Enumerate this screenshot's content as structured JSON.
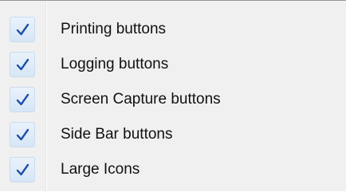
{
  "menu": {
    "items": [
      {
        "label": "Printing buttons",
        "checked": true,
        "icon": "checkmark-icon"
      },
      {
        "label": "Logging buttons",
        "checked": true,
        "icon": "checkmark-icon"
      },
      {
        "label": "Screen Capture buttons",
        "checked": true,
        "icon": "checkmark-icon"
      },
      {
        "label": "Side Bar buttons",
        "checked": true,
        "icon": "checkmark-icon"
      },
      {
        "label": "Large Icons",
        "checked": true,
        "icon": "checkmark-icon"
      }
    ]
  },
  "colors": {
    "menu_background": "#f0f0f0",
    "check_color": "#1f4fa8",
    "check_box_border": "#c9dcee"
  }
}
